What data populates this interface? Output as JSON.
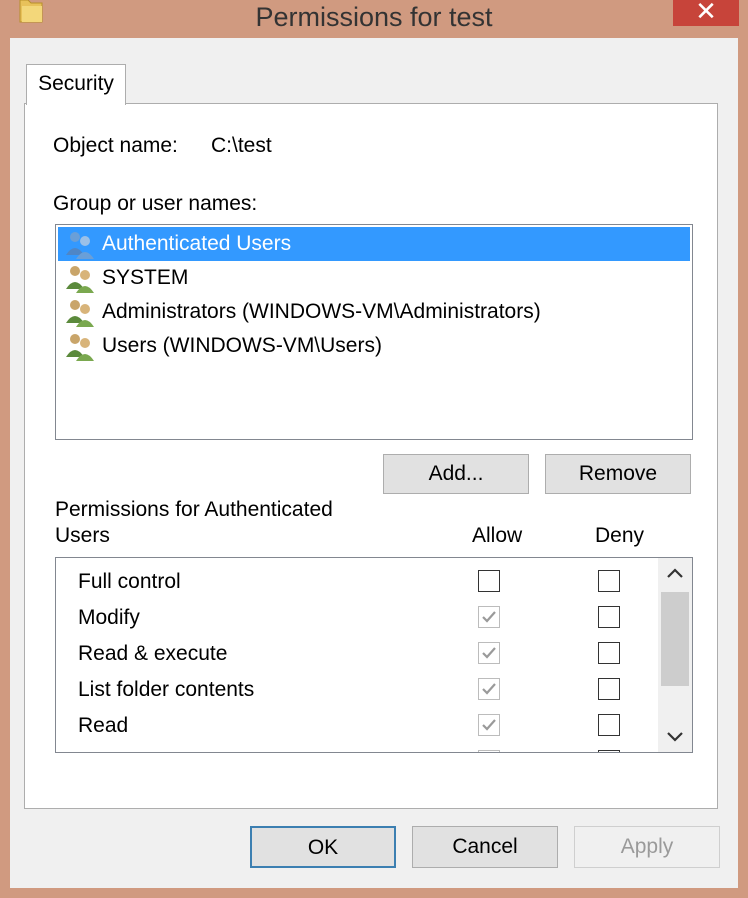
{
  "window": {
    "title": "Permissions for test",
    "close_glyph": "✕"
  },
  "tab": {
    "label": "Security"
  },
  "object": {
    "label": "Object name:",
    "value": "C:\\test"
  },
  "groups": {
    "label": "Group or user names:",
    "items": [
      {
        "name": "Authenticated Users",
        "selected": true
      },
      {
        "name": "SYSTEM",
        "selected": false
      },
      {
        "name": "Administrators (WINDOWS-VM\\Administrators)",
        "selected": false
      },
      {
        "name": "Users (WINDOWS-VM\\Users)",
        "selected": false
      }
    ],
    "add_label": "Add...",
    "remove_label": "Remove"
  },
  "permissions": {
    "title_line1": "Permissions for Authenticated",
    "title_line2": "Users",
    "allow_label": "Allow",
    "deny_label": "Deny",
    "rows": [
      {
        "name": "Full control",
        "allow": false,
        "allow_inherited": false,
        "deny": false
      },
      {
        "name": "Modify",
        "allow": true,
        "allow_inherited": true,
        "deny": false
      },
      {
        "name": "Read & execute",
        "allow": true,
        "allow_inherited": true,
        "deny": false
      },
      {
        "name": "List folder contents",
        "allow": true,
        "allow_inherited": true,
        "deny": false
      },
      {
        "name": "Read",
        "allow": true,
        "allow_inherited": true,
        "deny": false
      }
    ]
  },
  "footer": {
    "ok_label": "OK",
    "cancel_label": "Cancel",
    "apply_label": "Apply"
  },
  "colors": {
    "selection": "#3399ff",
    "close": "#c7443a",
    "frame": "#d09a80"
  },
  "icons": {
    "folder": "folder-icon",
    "user_group": "user-group-icon",
    "scroll_up": "chevron-up-icon",
    "scroll_down": "chevron-down-icon"
  }
}
